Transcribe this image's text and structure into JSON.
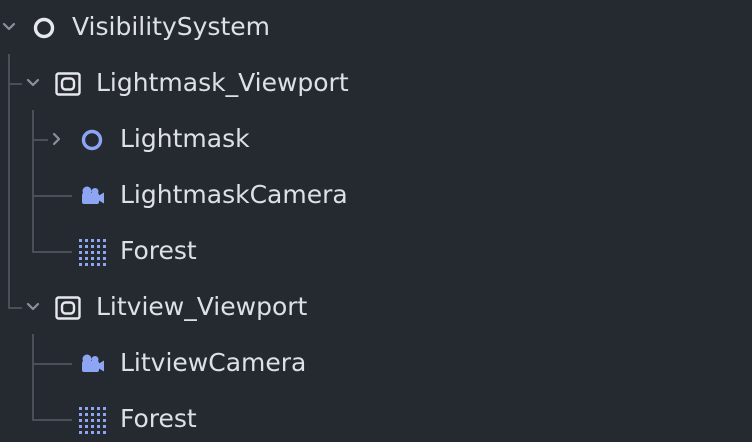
{
  "scene_tree": {
    "nodes": [
      {
        "label": "VisibilitySystem",
        "icon": "node2d-circle-icon",
        "expander": "expanded"
      },
      {
        "label": "Lightmask_Viewport",
        "icon": "subviewport-icon",
        "expander": "expanded"
      },
      {
        "label": "Lightmask",
        "icon": "node2d-circle-icon",
        "expander": "collapsed"
      },
      {
        "label": "LightmaskCamera",
        "icon": "camera2d-icon",
        "expander": "none"
      },
      {
        "label": "Forest",
        "icon": "tilemap-icon",
        "expander": "none"
      },
      {
        "label": "Litview_Viewport",
        "icon": "subviewport-icon",
        "expander": "expanded"
      },
      {
        "label": "LitviewCamera",
        "icon": "camera2d-icon",
        "expander": "none"
      },
      {
        "label": "Forest",
        "icon": "tilemap-icon",
        "expander": "none"
      }
    ]
  },
  "colors": {
    "background": "#252930",
    "text": "#dde0e6",
    "guide_line": "#4a4f58",
    "node_icon_white": "#e6e8ec",
    "node2d_icon_blue": "#8da5f3",
    "chevron": "#8c909a"
  }
}
